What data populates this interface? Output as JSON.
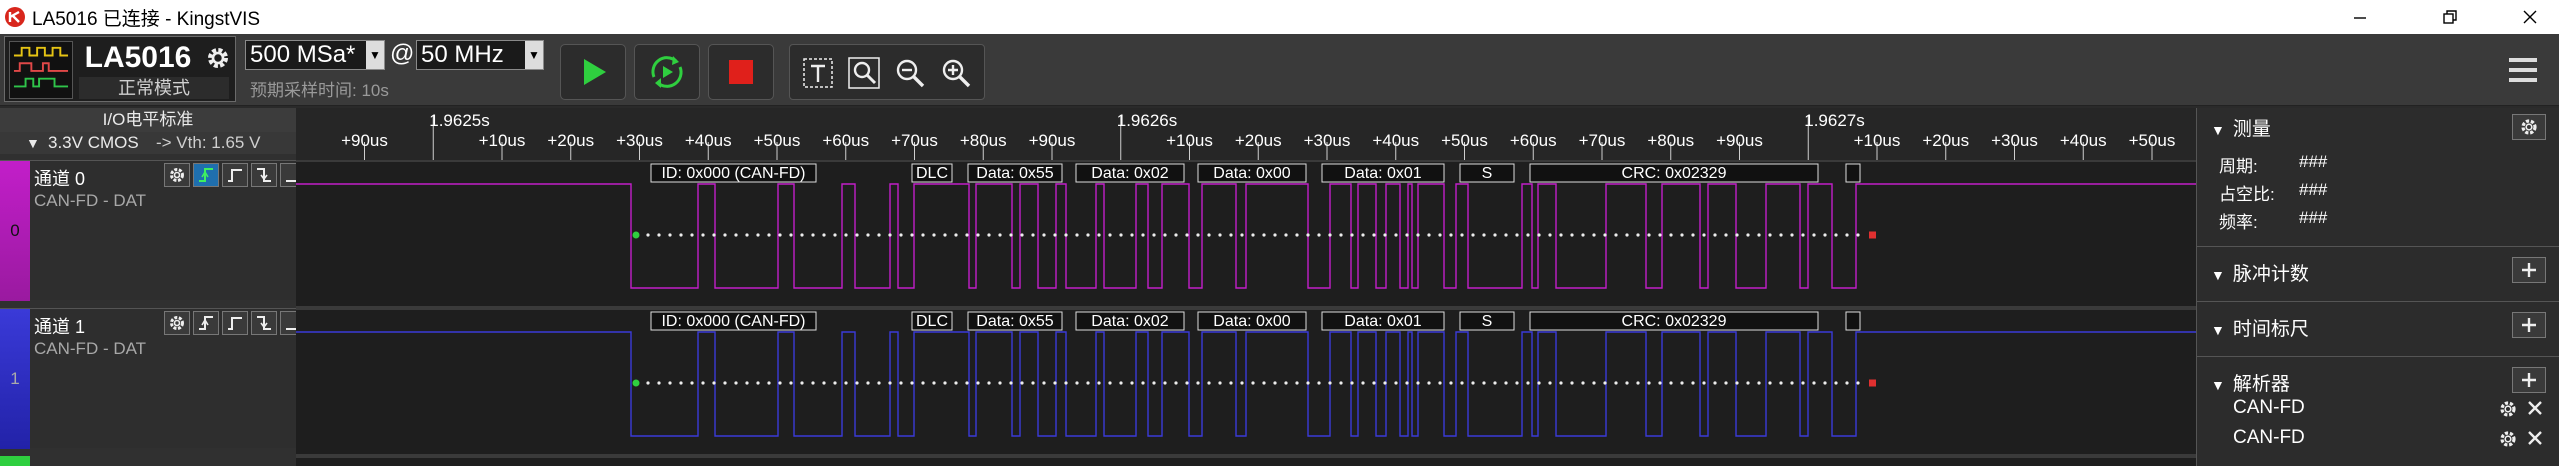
{
  "window": {
    "title": "LA5016 已连接 - KingstVIS",
    "controls": [
      "minimize",
      "maximize",
      "close"
    ]
  },
  "toolbar": {
    "device_model": "LA5016",
    "device_mode": "正常模式",
    "sample_rate": "500 MSa*",
    "at_symbol": "@",
    "frequency": "50 MHz",
    "preview_label": "预期采样时间: 10s",
    "buttons": [
      "start",
      "start-continuous",
      "stop"
    ],
    "tools": [
      "text",
      "search",
      "zoom-out",
      "zoom-in"
    ]
  },
  "left_panel": {
    "io_level_title": "I/O电平标准",
    "io_standard": "3.3V CMOS",
    "vth": "-> Vth: 1.65 V",
    "channels": [
      {
        "index": "0",
        "name": "通道 0",
        "protocol": "CAN-FD - DAT",
        "color": "#c21ec9"
      },
      {
        "index": "1",
        "name": "通道 1",
        "protocol": "CAN-FD - DAT",
        "color": "#3a3ad8"
      }
    ]
  },
  "timeline": {
    "ticks": [
      {
        "label": "+90us",
        "major": false
      },
      {
        "label": "1.9625s",
        "major": true
      },
      {
        "label": "+10us",
        "major": false
      },
      {
        "label": "+20us",
        "major": false
      },
      {
        "label": "+30us",
        "major": false
      },
      {
        "label": "+40us",
        "major": false
      },
      {
        "label": "+50us",
        "major": false
      },
      {
        "label": "+60us",
        "major": false
      },
      {
        "label": "+70us",
        "major": false
      },
      {
        "label": "+80us",
        "major": false
      },
      {
        "label": "+90us",
        "major": false
      },
      {
        "label": "1.9626s",
        "major": true
      },
      {
        "label": "+10us",
        "major": false
      },
      {
        "label": "+20us",
        "major": false
      },
      {
        "label": "+30us",
        "major": false
      },
      {
        "label": "+40us",
        "major": false
      },
      {
        "label": "+50us",
        "major": false
      },
      {
        "label": "+60us",
        "major": false
      },
      {
        "label": "+70us",
        "major": false
      },
      {
        "label": "+80us",
        "major": false
      },
      {
        "label": "+90us",
        "major": false
      },
      {
        "label": "1.9627s",
        "major": true
      },
      {
        "label": "+10us",
        "major": false
      },
      {
        "label": "+20us",
        "major": false
      },
      {
        "label": "+30us",
        "major": false
      },
      {
        "label": "+40us",
        "major": false
      },
      {
        "label": "+50us",
        "major": false
      }
    ]
  },
  "decode_fields": [
    "ID: 0x000 (CAN-FD)",
    "DLC",
    "Data: 0x55",
    "Data: 0x02",
    "Data: 0x00",
    "Data: 0x01",
    "S",
    "CRC: 0x02329",
    ""
  ],
  "right_panel": {
    "measure": {
      "title": "测量",
      "rows": [
        {
          "label": "周期:",
          "value": "###"
        },
        {
          "label": "占空比:",
          "value": "###"
        },
        {
          "label": "频率:",
          "value": "###"
        }
      ]
    },
    "pulse_count": {
      "title": "脉冲计数"
    },
    "time_marker": {
      "title": "时间标尺"
    },
    "analyzers": {
      "title": "解析器",
      "items": [
        "CAN-FD",
        "CAN-FD"
      ]
    }
  }
}
